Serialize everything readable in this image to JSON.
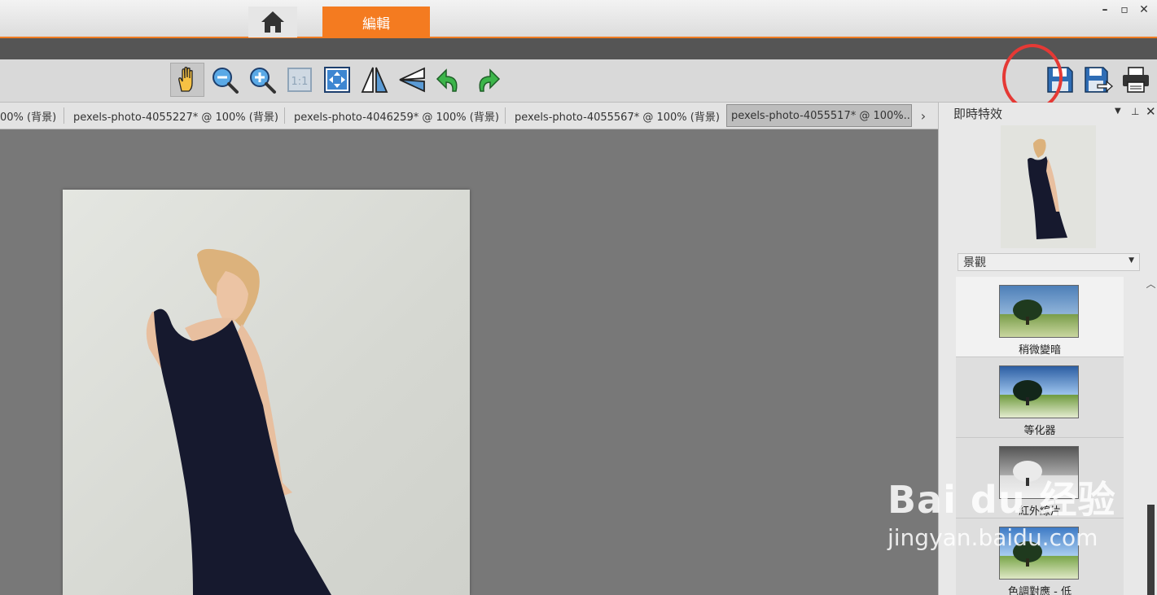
{
  "titlebar": {
    "edit_tab_label": "編輯",
    "accent": "#f47b20",
    "window_controls": [
      "minimize-icon",
      "restore-icon",
      "close-icon"
    ]
  },
  "toolbar": {
    "tools": [
      "hand-icon",
      "zoom-out-icon",
      "zoom-in-icon",
      "actual-size-icon",
      "fit-to-window-icon",
      "flip-horizontal-icon",
      "flip-vertical-icon",
      "rotate-left-icon",
      "rotate-right-icon"
    ],
    "actual_size_label": "1:1",
    "right_tools": [
      "save-icon",
      "save-as-icon",
      "print-icon"
    ]
  },
  "doc_tabs": [
    {
      "label": "00% (背景)"
    },
    {
      "label": "pexels-photo-4055227* @ 100% (背景)"
    },
    {
      "label": "pexels-photo-4046259* @ 100% (背景)"
    },
    {
      "label": "pexels-photo-4055567* @ 100% (背景)"
    },
    {
      "label": "pexels-photo-4055517* @ 100%..."
    }
  ],
  "panel": {
    "title": "即時特效",
    "category": "景觀",
    "effects": [
      {
        "label": "稍微變暗"
      },
      {
        "label": "等化器"
      },
      {
        "label": "紅外線片"
      },
      {
        "label": "色調對應 - 低"
      }
    ]
  },
  "watermark": {
    "logo": "Bai du 经验",
    "url": "jingyan.baidu.com"
  }
}
